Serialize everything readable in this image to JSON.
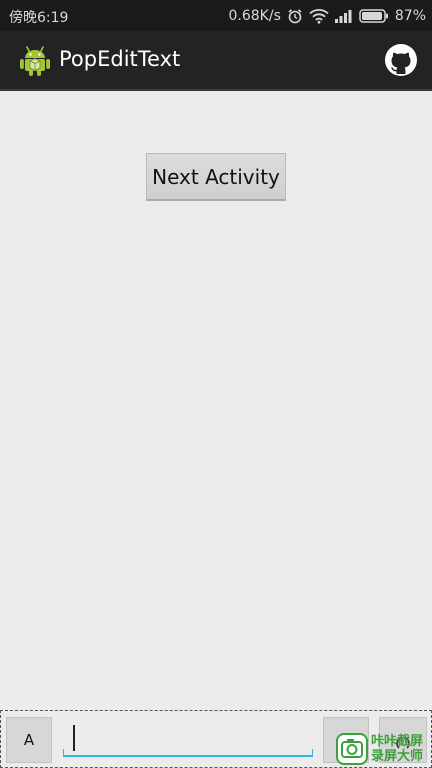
{
  "status_bar": {
    "time": "傍晚6:19",
    "network_speed": "0.68K/s",
    "battery_percent": "87%",
    "icons": [
      "alarm-clock-icon",
      "wifi-icon",
      "signal-icon",
      "battery-icon"
    ]
  },
  "action_bar": {
    "title": "PopEditText",
    "app_icon": "android-robot-icon",
    "right_icon": "github-icon",
    "background": "#232323"
  },
  "main": {
    "next_button_label": "Next Activity",
    "background": "#ececec"
  },
  "input_bar": {
    "mode_button_label": "A",
    "input_value": "",
    "input_placeholder": "",
    "accent_color": "#33b5e5",
    "send_icon": "refresh-icon"
  },
  "watermark": {
    "line1": "咔咔截屏",
    "line2": "录屏大师",
    "color": "#3da13a"
  }
}
